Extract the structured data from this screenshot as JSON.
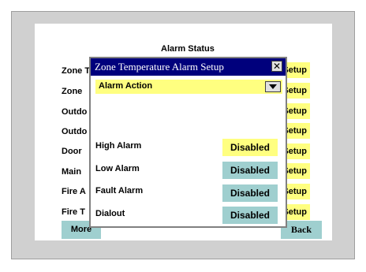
{
  "alarm_status": {
    "title": "Alarm Status",
    "rows": [
      {
        "label": "Zone T",
        "button": "Setup"
      },
      {
        "label": "Zone",
        "button": "Setup"
      },
      {
        "label": "Outdo",
        "button": "Setup"
      },
      {
        "label": "Outdo",
        "button": "Setup"
      },
      {
        "label": "Door",
        "button": "Setup"
      },
      {
        "label": "Main",
        "button": "Setup"
      },
      {
        "label": "Fire A",
        "button": "Setup"
      },
      {
        "label": "Fire T",
        "button": "Setup"
      }
    ],
    "more_label": "More",
    "back_label": "Back"
  },
  "dialog": {
    "title": "Zone Temperature Alarm Setup",
    "close_glyph": "✕",
    "action_label": "Alarm Action",
    "alarms": [
      {
        "label": "High Alarm",
        "value": "Disabled",
        "color": "#ffff80"
      },
      {
        "label": "Low Alarm",
        "value": "Disabled",
        "color": "#9fcfcf"
      },
      {
        "label": "Fault Alarm",
        "value": "Disabled",
        "color": "#9fcfcf"
      },
      {
        "label": "Dialout",
        "value": "Disabled",
        "color": "#9fcfcf"
      }
    ]
  }
}
